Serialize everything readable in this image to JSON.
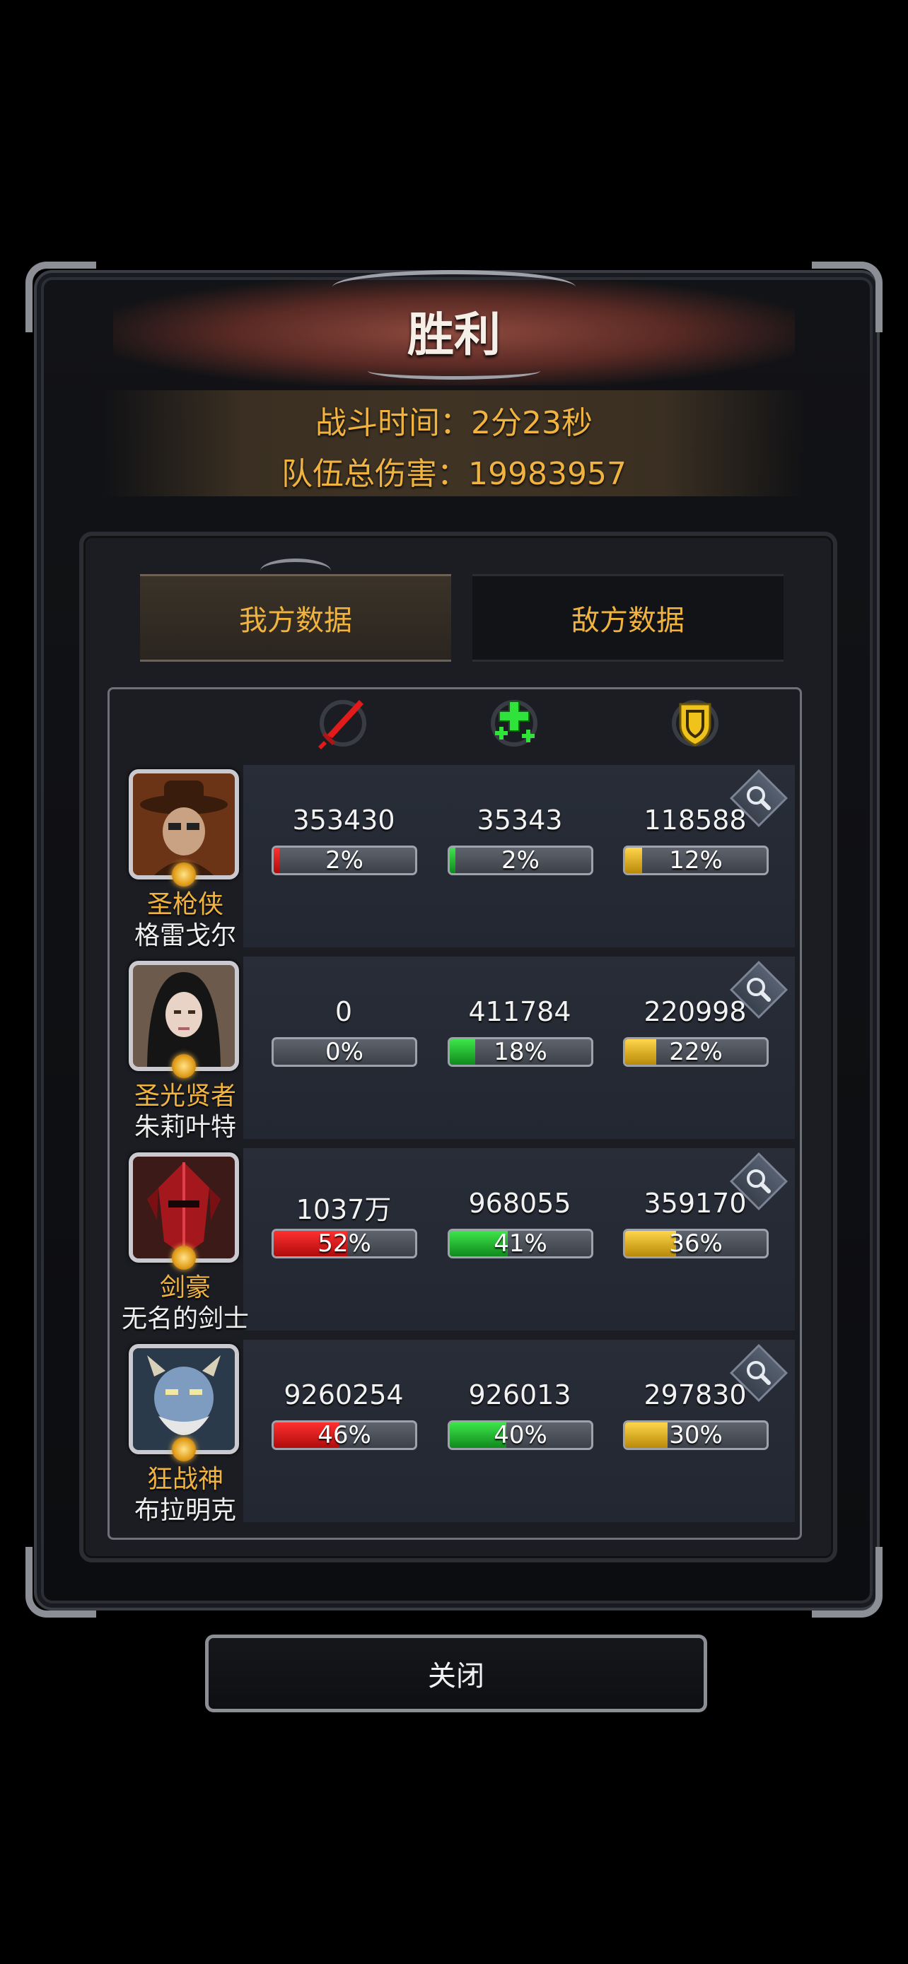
{
  "title": "胜利",
  "summary": {
    "battle_time": "战斗时间：2分23秒",
    "team_damage": "队伍总伤害：19983957"
  },
  "tabs": [
    {
      "label": "我方数据",
      "active": true
    },
    {
      "label": "敌方数据",
      "active": false
    }
  ],
  "stat_icons": [
    "sword-icon",
    "heal-plus-icon",
    "shield-icon"
  ],
  "colors": {
    "accent": "#f0b340",
    "damage": "#d41a1a",
    "heal": "#1ea52c",
    "tank": "#e3b21e",
    "banner": "#7a3a31"
  },
  "heroes": [
    {
      "class": "圣枪侠",
      "name": "格雷戈尔",
      "portrait": "gunslinger-hat-portrait",
      "damage": {
        "value": "353430",
        "pct_label": "2%",
        "fill": 0.02
      },
      "heal": {
        "value": "35343",
        "pct_label": "2%",
        "fill": 0.02
      },
      "tank": {
        "value": "118588",
        "pct_label": "12%",
        "fill": 0.12
      }
    },
    {
      "class": "圣光贤者",
      "name": "朱莉叶特",
      "portrait": "nun-portrait",
      "damage": {
        "value": "0",
        "pct_label": "0%",
        "fill": 0.0
      },
      "heal": {
        "value": "411784",
        "pct_label": "18%",
        "fill": 0.18
      },
      "tank": {
        "value": "220998",
        "pct_label": "22%",
        "fill": 0.22
      }
    },
    {
      "class": "剑豪",
      "name": "无名的剑士",
      "portrait": "red-helm-portrait",
      "damage": {
        "value": "1037万",
        "pct_label": "52%",
        "fill": 0.52
      },
      "heal": {
        "value": "968055",
        "pct_label": "41%",
        "fill": 0.41
      },
      "tank": {
        "value": "359170",
        "pct_label": "36%",
        "fill": 0.36
      }
    },
    {
      "class": "狂战神",
      "name": "布拉明克",
      "portrait": "blue-ogre-portrait",
      "damage": {
        "value": "9260254",
        "pct_label": "46%",
        "fill": 0.46
      },
      "heal": {
        "value": "926013",
        "pct_label": "40%",
        "fill": 0.4
      },
      "tank": {
        "value": "297830",
        "pct_label": "30%",
        "fill": 0.3
      }
    }
  ],
  "close_label": "关闭"
}
